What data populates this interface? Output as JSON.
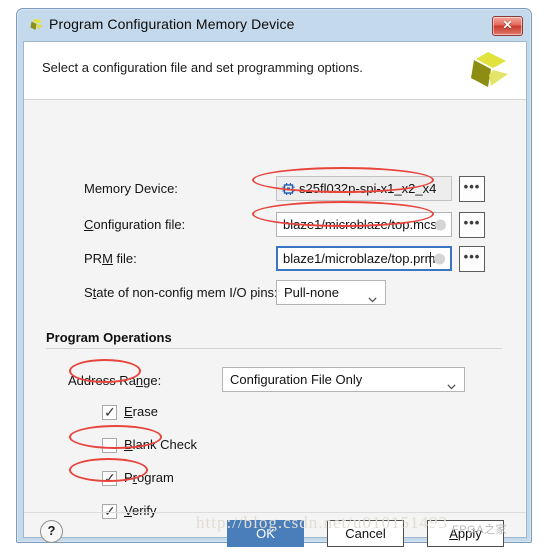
{
  "window": {
    "title": "Program Configuration Memory Device",
    "close_label": "✕",
    "logo_name": "xilinx-logo"
  },
  "header": {
    "instruction": "Select a configuration file and set programming options."
  },
  "fields": {
    "memory_device": {
      "label": "Memory Device:",
      "value": "s25fl032p-spi-x1_x2_x4",
      "browse_label": "•••"
    },
    "configuration_file": {
      "label_pre": "",
      "label_mnemonic": "C",
      "label_post": "onfiguration file:",
      "value": "blaze1/microblaze/top.mcs",
      "browse_label": "•••"
    },
    "prm_file": {
      "label_pre": "PR",
      "label_mnemonic": "M",
      "label_post": " file:",
      "value": "blaze1/microblaze/top.prm",
      "browse_label": "•••"
    },
    "io_pins_state": {
      "label_pre": "S",
      "label_mnemonic": "t",
      "label_post": "ate of non-config mem I/O pins:",
      "value": "Pull-none"
    }
  },
  "program_operations": {
    "title": "Program Operations",
    "address_range": {
      "label_pre": "Address Ra",
      "label_mnemonic": "n",
      "label_post": "ge:",
      "value": "Configuration File Only"
    },
    "checkboxes": [
      {
        "name": "erase",
        "pre": "",
        "mnemonic": "E",
        "post": "rase",
        "checked": true,
        "tick": "✓"
      },
      {
        "name": "blank-check",
        "pre": "",
        "mnemonic": "B",
        "post": "lank Check",
        "checked": false,
        "tick": ""
      },
      {
        "name": "program",
        "pre": "P",
        "mnemonic": "r",
        "post": "ogram",
        "checked": true,
        "tick": "✓"
      },
      {
        "name": "verify",
        "pre": "",
        "mnemonic": "V",
        "post": "erify",
        "checked": true,
        "tick": "✓"
      }
    ]
  },
  "footer": {
    "help_label": "?",
    "ok_label": "OK",
    "cancel_label": "Cancel",
    "apply_pre": "",
    "apply_mnemonic": "A",
    "apply_post": "pply"
  },
  "watermark": {
    "url": "http://blog.csdn.net/u010151493",
    "brand": "FPGA之家"
  },
  "colors": {
    "accent_blue": "#4a7ebb",
    "frame_blue": "#c5d9ec",
    "annotation_red": "#e8443c",
    "focus_blue": "#3a74c4",
    "logo_yellow": "#d7d92a"
  }
}
